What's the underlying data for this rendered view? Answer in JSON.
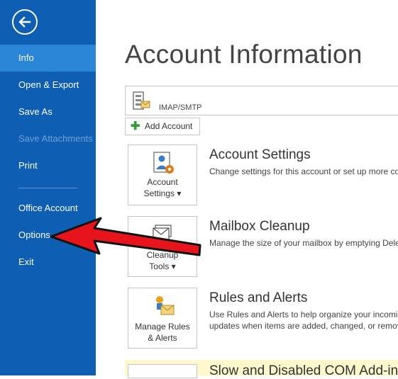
{
  "sidebar": {
    "back_icon": "back-arrow-icon",
    "items": [
      {
        "label": "Info",
        "state": "active"
      },
      {
        "label": "Open & Export",
        "state": "normal"
      },
      {
        "label": "Save As",
        "state": "normal"
      },
      {
        "label": "Save Attachments",
        "state": "disabled"
      },
      {
        "label": "Print",
        "state": "normal"
      },
      {
        "label": "Office Account",
        "state": "normal"
      },
      {
        "label": "Options",
        "state": "normal"
      },
      {
        "label": "Exit",
        "state": "normal"
      }
    ]
  },
  "main": {
    "title": "Account Information",
    "account_type": "IMAP/SMTP",
    "add_account_label": "Add Account",
    "sections": [
      {
        "tile_line1": "Account",
        "tile_line2": "Settings ▾",
        "title": "Account Settings",
        "desc1": "Change settings for this account or set up more co",
        "desc2": ""
      },
      {
        "tile_line1": "Cleanup",
        "tile_line2": "Tools ▾",
        "title": "Mailbox Cleanup",
        "desc1": "Manage the size of your mailbox by emptying Dele",
        "desc2": ""
      },
      {
        "tile_line1": "Manage Rules",
        "tile_line2": "& Alerts",
        "title": "Rules and Alerts",
        "desc1": "Use Rules and Alerts to help organize your incomin",
        "desc2": "updates when items are added, changed, or remov"
      },
      {
        "title": "Slow and Disabled COM Add-ins"
      }
    ]
  },
  "colors": {
    "sidebar": "#0e5fb4",
    "sidebar_active": "#2c86d8",
    "annotation_arrow": "#e8141c"
  }
}
